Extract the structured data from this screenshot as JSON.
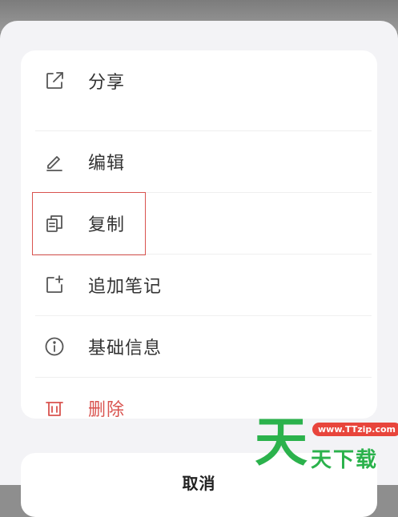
{
  "menu": {
    "items": [
      {
        "label": "分享",
        "icon": "share-icon"
      },
      {
        "label": "编辑",
        "icon": "edit-icon"
      },
      {
        "label": "复制",
        "icon": "copy-icon"
      },
      {
        "label": "追加笔记",
        "icon": "add-note-icon"
      },
      {
        "label": "基础信息",
        "icon": "info-icon"
      },
      {
        "label": "删除",
        "icon": "trash-icon"
      }
    ]
  },
  "cancel_label": "取消",
  "watermark": {
    "big_char": "天",
    "url": "www.TTzip.com",
    "text": "天下载"
  },
  "colors": {
    "danger": "#d9534f",
    "icon": "#555555",
    "watermark_green": "#2bb24c",
    "watermark_red": "#e8453c"
  }
}
